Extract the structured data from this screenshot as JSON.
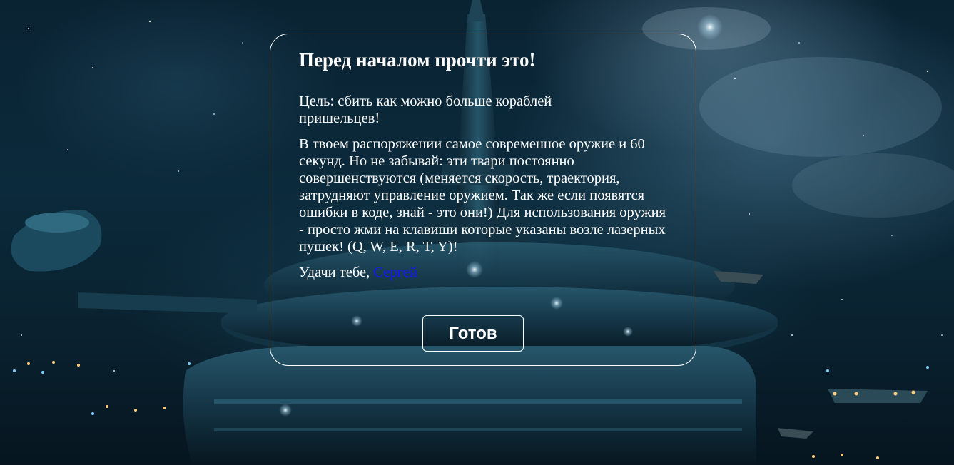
{
  "intro": {
    "title": "Перед началом прочти это!",
    "goal": "Цель: сбить как можно больше кораблей пришельцев!",
    "description": "В твоем распоряжении самое современное оружие и 60 секунд. Но не забывай: эти твари постоянно совершенствуются (меняется скорость, траектория, затрудняют управление оружием. Так же если появятся ошибки в коде, знай - это они!) Для использования оружия - просто жми на клавиши которые указаны возле лазерных пушек! (Q, W, E, R, T, Y)!",
    "luck_prefix": "Удачи тебе,",
    "player_name": "Сергей",
    "ready_label": "Готов"
  },
  "weapon_keys": [
    "Q",
    "W",
    "E",
    "R",
    "T",
    "Y"
  ],
  "time_limit_seconds": 60,
  "colors": {
    "text": "#ffffff",
    "player_name": "#1515ff",
    "dialog_border": "#ffffff",
    "button_border": "#ffffff"
  }
}
